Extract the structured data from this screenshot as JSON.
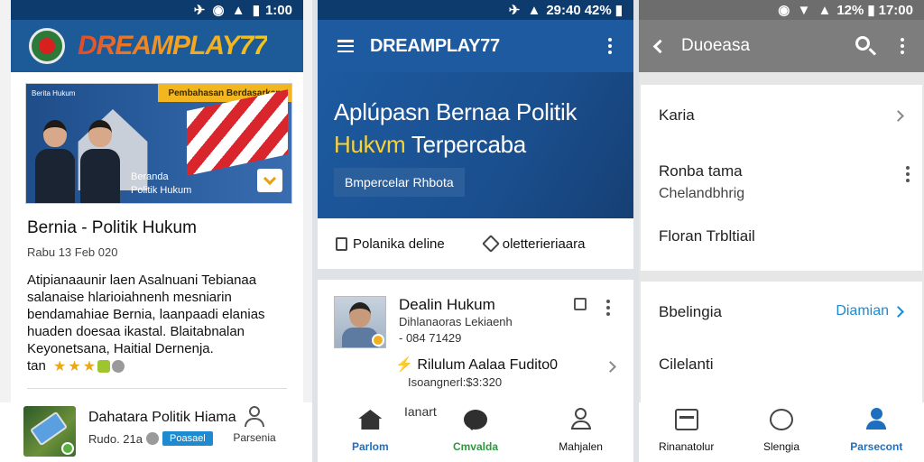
{
  "panel1": {
    "status_time": "1:00",
    "brand": "DREAMPLAY77",
    "hero": {
      "small_tag": "Berita Hukum",
      "ribbon": "Pembahasan Berdasarkan",
      "caption_line1": "Beranda",
      "caption_line2": "Politik Hukum"
    },
    "article": {
      "title": "Bernia - Politik Hukum",
      "date": "Rabu 13 Feb 020",
      "body": "Atipianaaunir laen Asalnuani Tebianaa salanaise hlarioiahnenh mesniarin bendamahiae Bernia, laanpaadi elanias huaden doesaa ikastal. Blaitabnalan Keyonetsana, Haitial Dernenja.",
      "footer_text": "tan"
    },
    "bottom_card": {
      "title": "Dahatara Politik Hiama",
      "meta": "Rudo. 21a",
      "badge": "Poasael",
      "side_label": "Parsenia"
    }
  },
  "panel2": {
    "status_time": "29:40",
    "status_battery": "42%",
    "title": "DREAMPLAY77",
    "banner": {
      "line1": "Aplúpasn Bernaa Politik",
      "line2_highlight": "Hukvm",
      "line2_rest": "Terpercaba",
      "tag": "Bmpercelar Rhbota"
    },
    "actions": {
      "left": "Polanika deline",
      "right": "oletterieriaara"
    },
    "card": {
      "title": "Dealin Hukum",
      "subtitle": "Dihlanaoras Lekiaenh",
      "code": "- 084 71429",
      "link": "Rilulum Aalaa Fudito0",
      "time": "Isoangnerl:$3:320"
    },
    "tabs": [
      {
        "label": "Parlom"
      },
      {
        "label": "Cmvalda"
      },
      {
        "label": "Mahjalen"
      }
    ],
    "tab_overlay_label": "Ianart"
  },
  "panel3": {
    "status_time": "17:00",
    "status_battery": "12%",
    "title": "Duoeasa",
    "section1": [
      {
        "label": "Karia"
      },
      {
        "label": "Ronba tama",
        "sub": "Chelandbhrig"
      },
      {
        "label": "Floran Trbltiail"
      }
    ],
    "section2": [
      {
        "label": "Bbelingia",
        "link": "Diamian"
      },
      {
        "label": "Cilelanti"
      }
    ],
    "tabs": [
      {
        "label": "Rinanatolur"
      },
      {
        "label": "Slengia"
      },
      {
        "label": "Parsecont"
      }
    ]
  },
  "colors": {
    "primary_blue": "#1d5aa0",
    "dark_blue": "#0e3b6e",
    "highlight_yellow": "#f6d33a",
    "accent_green": "#2a9a3a",
    "link_blue": "#1f8ad0",
    "gray_appbar": "#7d7d7d"
  },
  "rating": {
    "stars": 3,
    "max": 3
  }
}
